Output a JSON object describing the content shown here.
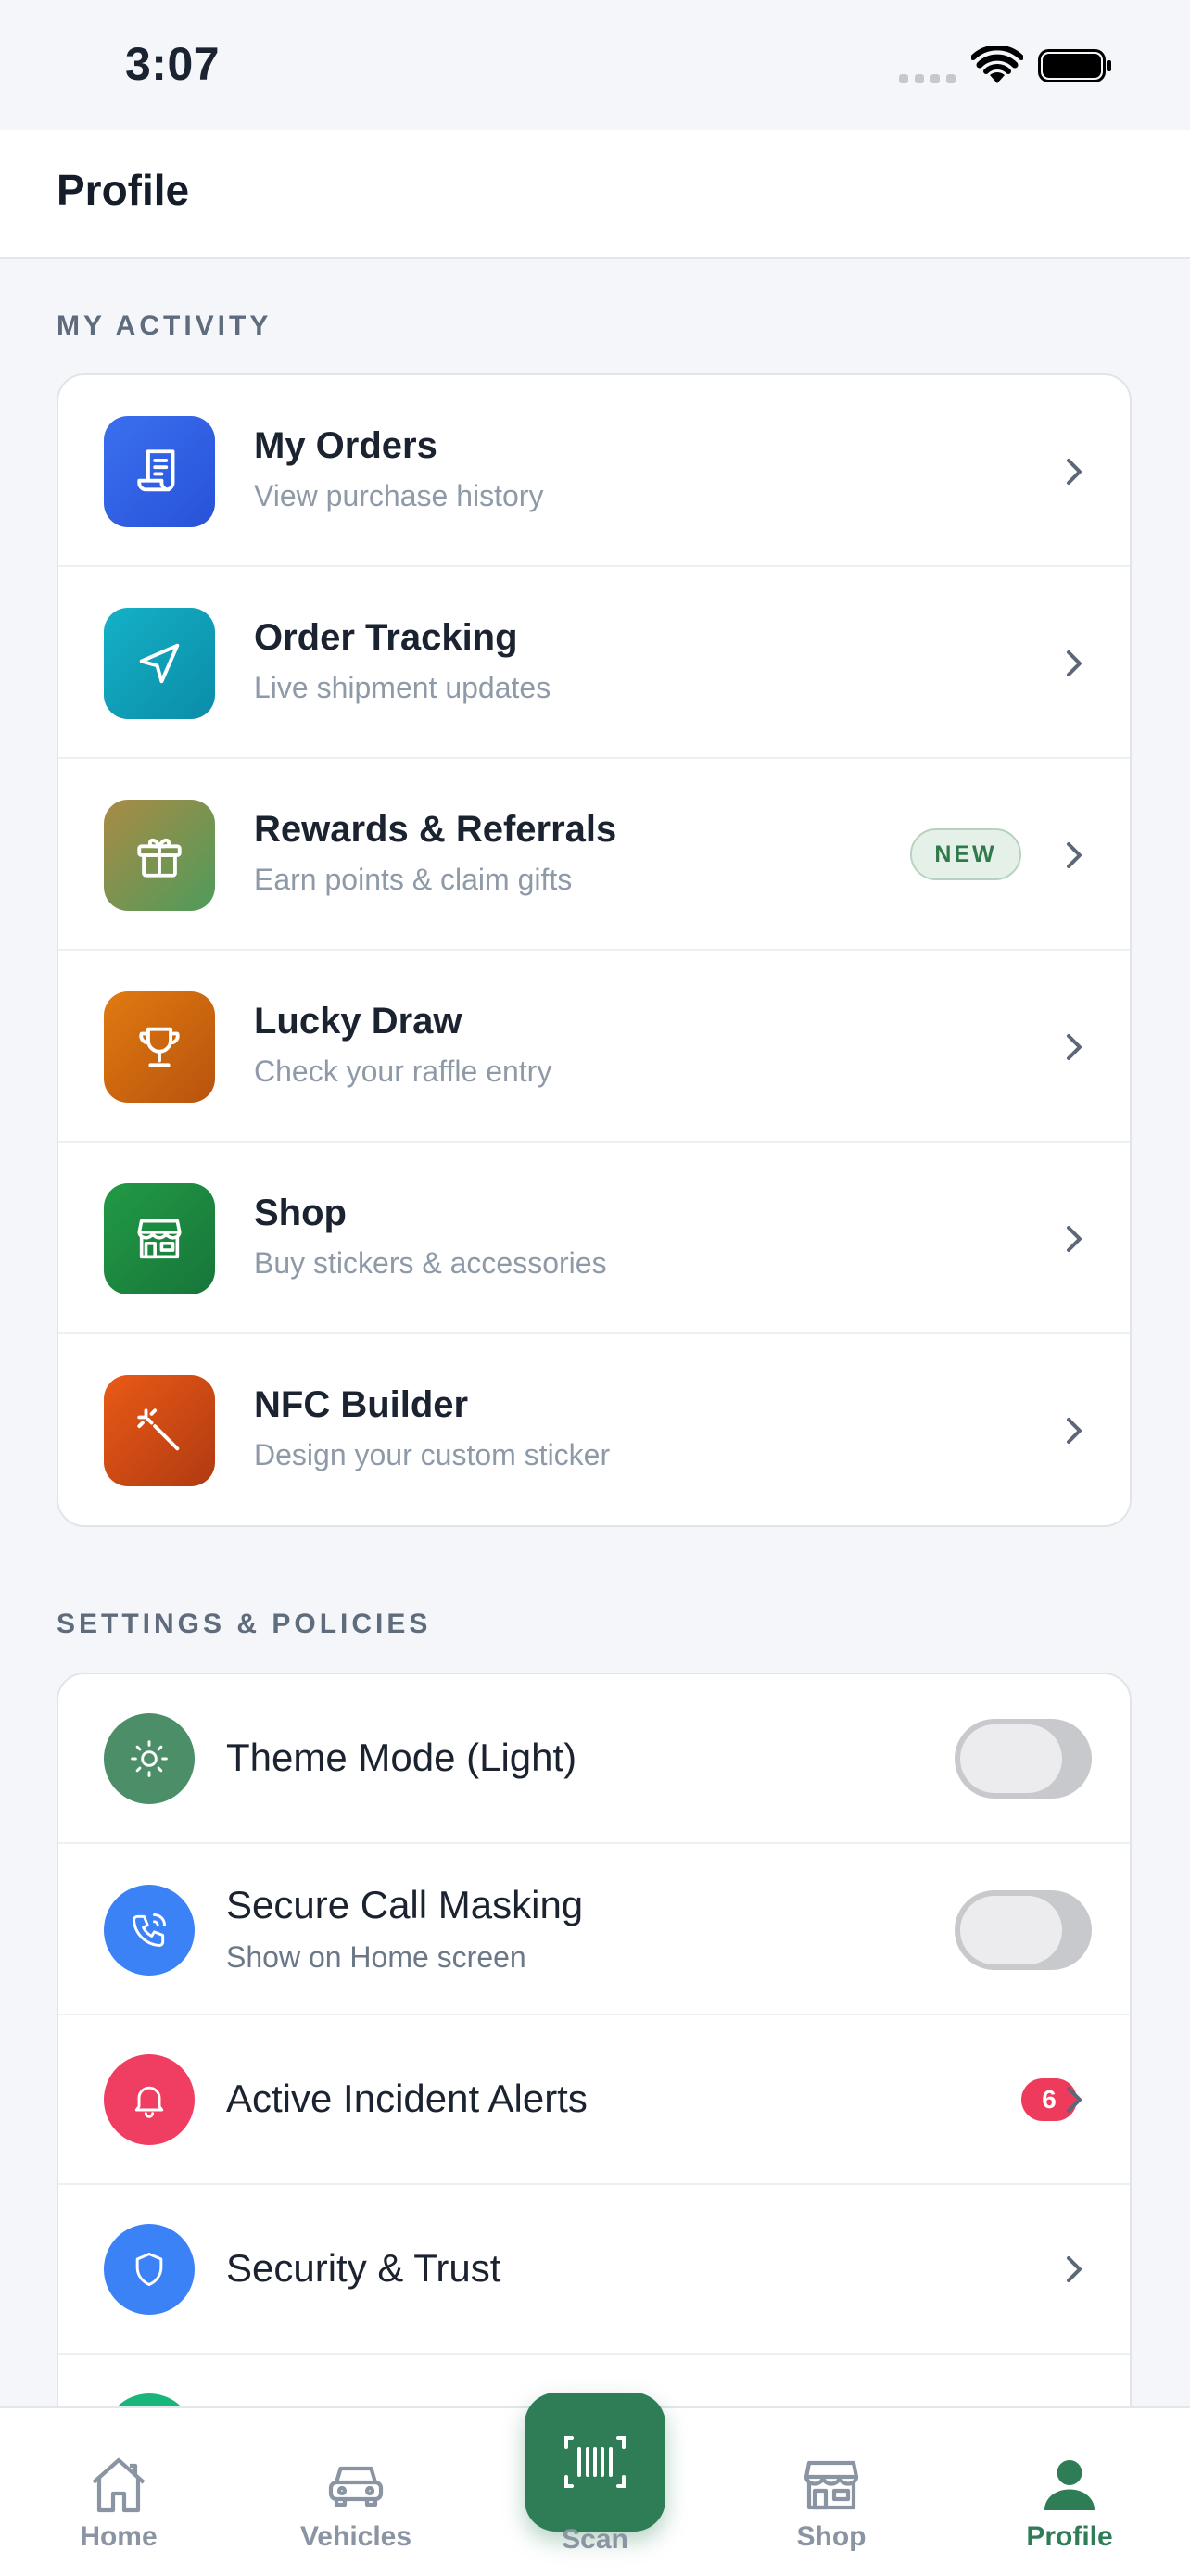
{
  "status_bar": {
    "time": "3:07"
  },
  "header": {
    "title": "Profile"
  },
  "my_activity": {
    "label": "MY ACTIVITY",
    "items": [
      {
        "title": "My Orders",
        "subtitle": "View purchase history",
        "icon": "receipt-icon"
      },
      {
        "title": "Order Tracking",
        "subtitle": "Live shipment updates",
        "icon": "navigation-arrow-icon"
      },
      {
        "title": "Rewards & Referrals",
        "subtitle": "Earn points & claim gifts",
        "icon": "gift-icon",
        "badge": "NEW"
      },
      {
        "title": "Lucky Draw",
        "subtitle": "Check your raffle entry",
        "icon": "trophy-icon"
      },
      {
        "title": "Shop",
        "subtitle": "Buy stickers & accessories",
        "icon": "storefront-icon"
      },
      {
        "title": "NFC Builder",
        "subtitle": "Design your custom sticker",
        "icon": "magic-wand-icon"
      }
    ]
  },
  "settings": {
    "label": "SETTINGS & POLICIES",
    "items": [
      {
        "title": "Theme Mode (Light)",
        "icon": "sun-icon",
        "toggle_on": false
      },
      {
        "title": "Secure Call Masking",
        "subtitle": "Show on Home screen",
        "icon": "phone-icon",
        "toggle_on": false
      },
      {
        "title": "Active Incident Alerts",
        "icon": "bell-icon",
        "count": "6"
      },
      {
        "title": "Security & Trust",
        "icon": "shield-icon"
      }
    ]
  },
  "bottom_nav": {
    "items": [
      {
        "label": "Home",
        "icon": "home-icon"
      },
      {
        "label": "Vehicles",
        "icon": "car-icon"
      },
      {
        "label": "Scan",
        "icon": "barcode-scan-icon"
      },
      {
        "label": "Shop",
        "icon": "storefront-icon"
      },
      {
        "label": "Profile",
        "icon": "user-icon",
        "active": true
      }
    ]
  },
  "colors": {
    "accent_green": "#2f7d57",
    "alert_red": "#ee3b5b",
    "orders_blue": "#3563e9",
    "tracking_teal": "#0f9fb8",
    "lucky_orange": "#d4680e",
    "shop_green": "#1f8a3e",
    "nfc_orange": "#e0501a"
  }
}
